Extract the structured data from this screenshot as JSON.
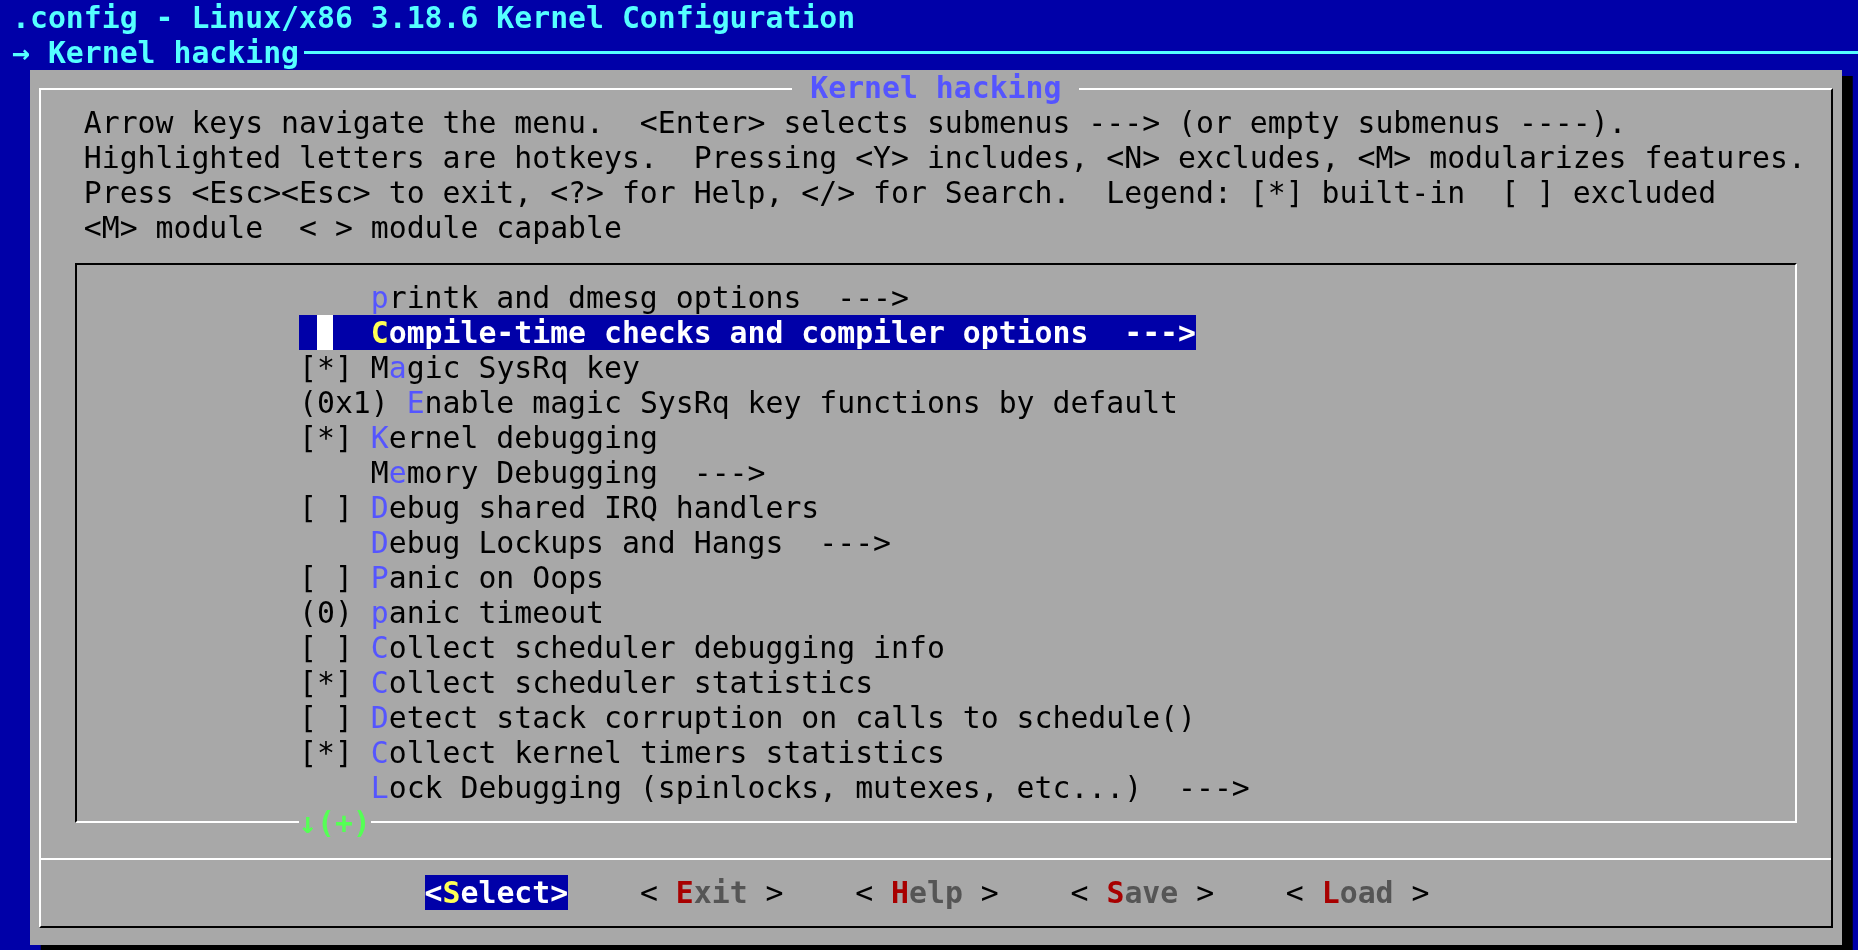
{
  "window": {
    "title": ".config - Linux/x86 3.18.6 Kernel Configuration"
  },
  "breadcrumb": "→ Kernel hacking",
  "dialog": {
    "title": "Kernel hacking",
    "help_lines": [
      "Arrow keys navigate the menu.  <Enter> selects submenus ---> (or empty submenus ----).",
      "Highlighted letters are hotkeys.  Pressing <Y> includes, <N> excludes, <M> modularizes features.",
      "Press <Esc><Esc> to exit, <?> for Help, </> for Search.  Legend: [*] built-in  [ ] excluded",
      "<M> module  < > module capable"
    ],
    "items": [
      {
        "hotkey": "p",
        "rest": "rintk and dmesg options  --->",
        "selected": false
      },
      {
        "hotkey": "C",
        "rest": "ompile-time checks and compiler options  --->",
        "selected": true
      },
      {
        "prefix": "[*]",
        "lead": "M",
        "hotkey": "a",
        "rest": "gic SysRq key",
        "selected": false
      },
      {
        "prefix": "(0x1)",
        "hotkey": "E",
        "rest": "nable magic SysRq key functions by default",
        "selected": false
      },
      {
        "prefix": "[*]",
        "hotkey": "K",
        "rest": "ernel debugging",
        "selected": false
      },
      {
        "lead": "M",
        "hotkey": "e",
        "rest": "mory Debugging  --->",
        "selected": false
      },
      {
        "prefix": "[ ]",
        "hotkey": "D",
        "rest": "ebug shared IRQ handlers",
        "selected": false
      },
      {
        "hotkey": "D",
        "rest": "ebug Lockups and Hangs  --->",
        "selected": false
      },
      {
        "prefix": "[ ]",
        "hotkey": "P",
        "rest": "anic on Oops",
        "selected": false
      },
      {
        "prefix": "(0)",
        "hotkey": "p",
        "rest": "anic timeout",
        "selected": false
      },
      {
        "prefix": "[ ]",
        "hotkey": "C",
        "rest": "ollect scheduler debugging info",
        "selected": false
      },
      {
        "prefix": "[*]",
        "hotkey": "C",
        "rest": "ollect scheduler statistics",
        "selected": false
      },
      {
        "prefix": "[ ]",
        "hotkey": "D",
        "rest": "etect stack corruption on calls to schedule()",
        "selected": false
      },
      {
        "prefix": "[*]",
        "hotkey": "C",
        "rest": "ollect kernel timers statistics",
        "selected": false
      },
      {
        "hotkey": "L",
        "rest": "ock Debugging (spinlocks, mutexes, etc...)  --->",
        "selected": false
      }
    ],
    "more_indicator": "↓(+)",
    "buttons": [
      {
        "open": "<",
        "hotkey": "S",
        "rest": "elect",
        "close": ">",
        "selected": true
      },
      {
        "open": "< ",
        "hotkey": "E",
        "rest": "xit",
        "close": " >",
        "selected": false
      },
      {
        "open": "< ",
        "hotkey": "H",
        "rest": "elp",
        "close": " >",
        "selected": false
      },
      {
        "open": "< ",
        "hotkey": "S",
        "rest": "ave",
        "close": " >",
        "selected": false
      },
      {
        "open": "< ",
        "hotkey": "L",
        "rest": "oad",
        "close": " >",
        "selected": false
      }
    ]
  }
}
